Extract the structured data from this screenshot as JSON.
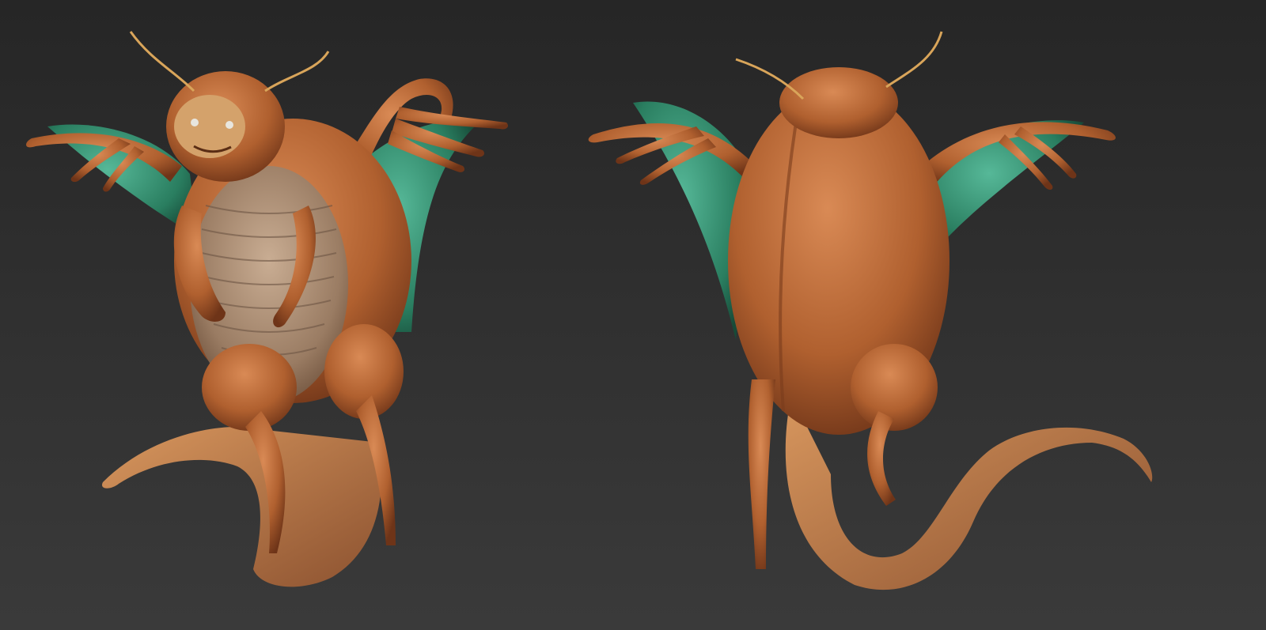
{
  "scene": {
    "background_colors": [
      "#262626",
      "#2e2e2e",
      "#3a3a3a"
    ],
    "creature_skin_color": "#b8683a",
    "creature_belly_color": "#9c8470",
    "membrane_color": "#2e8f6e",
    "antenna_color": "#d9a55a",
    "views": [
      {
        "name": "front-view"
      },
      {
        "name": "back-view"
      }
    ]
  }
}
